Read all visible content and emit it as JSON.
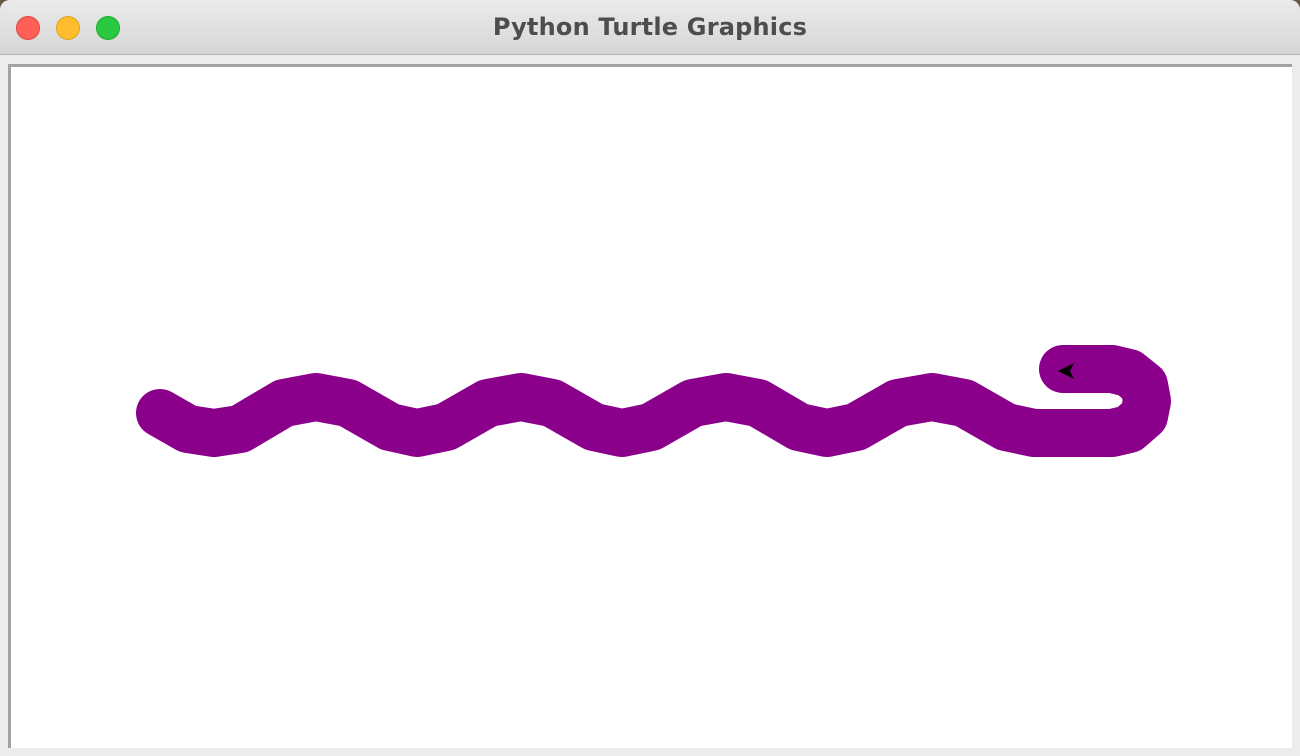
{
  "window": {
    "title": "Python Turtle Graphics"
  },
  "drawing": {
    "pen_color": "#8b008b",
    "background_color": "#ffffff",
    "turtle_color": "#000000",
    "turtle_shape": "classic-arrow-icon"
  }
}
